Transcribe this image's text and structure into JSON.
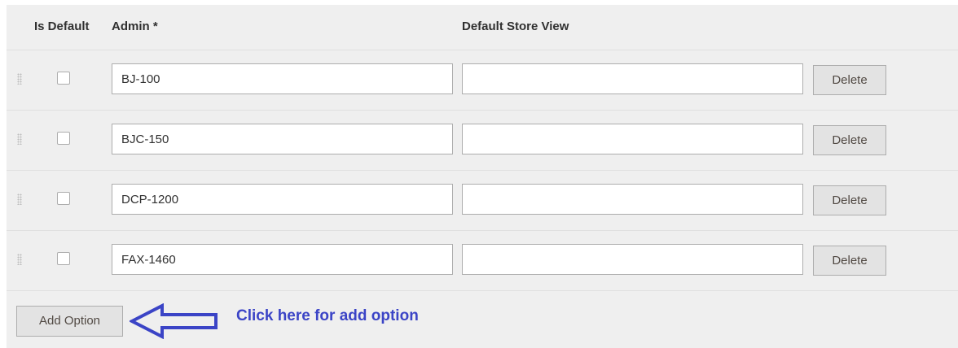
{
  "header": {
    "is_default": "Is Default",
    "admin": "Admin",
    "required_mark": "*",
    "default_store_view": "Default Store View"
  },
  "rows": [
    {
      "admin_value": "BJ-100",
      "store_value": "",
      "is_default": false,
      "delete_label": "Delete"
    },
    {
      "admin_value": "BJC-150",
      "store_value": "",
      "is_default": false,
      "delete_label": "Delete"
    },
    {
      "admin_value": "DCP-1200",
      "store_value": "",
      "is_default": false,
      "delete_label": "Delete"
    },
    {
      "admin_value": "FAX-1460",
      "store_value": "",
      "is_default": false,
      "delete_label": "Delete"
    }
  ],
  "footer": {
    "add_option_label": "Add Option",
    "annotation_text": "Click here for add option",
    "annotation_color": "#3b44c6"
  },
  "icons": {
    "drag_handle": "drag-handle-icon",
    "annotation_arrow": "left-arrow-icon"
  }
}
